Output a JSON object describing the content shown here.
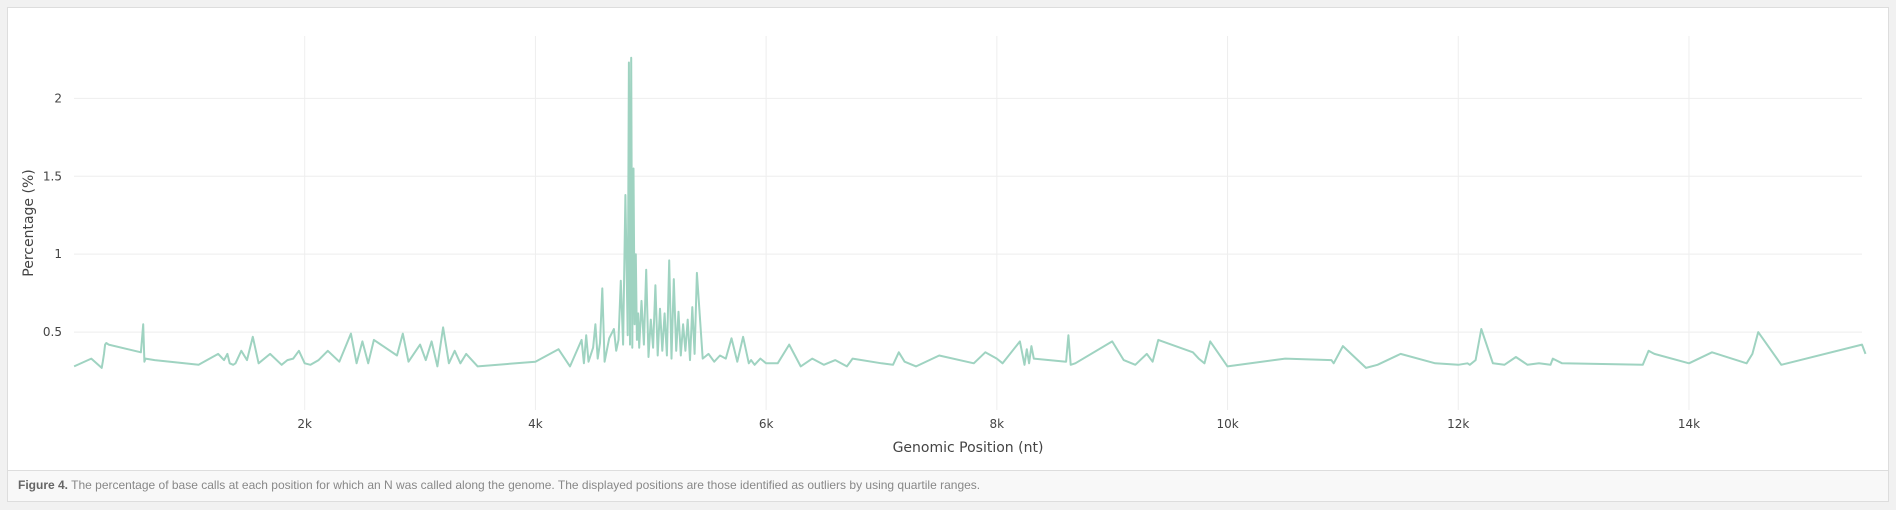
{
  "figure": {
    "label": "Figure 4.",
    "caption": "The percentage of base calls at each position for which an N was called along the genome. The displayed positions are those identified as outliers by using quartile ranges."
  },
  "chart_data": {
    "type": "line",
    "title": "",
    "xlabel": "Genomic Position (nt)",
    "ylabel": "Percentage (%)",
    "xlim": [
      0,
      15500
    ],
    "ylim": [
      0,
      2.4
    ],
    "xticks": [
      2000,
      4000,
      6000,
      8000,
      10000,
      12000,
      14000
    ],
    "xtick_labels": [
      "2k",
      "4k",
      "6k",
      "8k",
      "10k",
      "12k",
      "14k"
    ],
    "yticks": [
      0.5,
      1,
      1.5,
      2
    ],
    "ytick_labels": [
      "0.5",
      "1",
      "1.5",
      "2"
    ],
    "grid": true,
    "legend": "none",
    "line_color": "#9fd3c1",
    "series": [
      {
        "x": [
          1,
          150,
          240,
          250,
          260,
          270,
          280,
          300,
          580,
          600,
          610,
          620,
          700,
          1080,
          1250,
          1300,
          1330,
          1350,
          1380,
          1400,
          1450,
          1500,
          1550,
          1600,
          1700,
          1800,
          1850,
          1900,
          1950,
          2000,
          2050,
          2120,
          2200,
          2300,
          2350,
          2400,
          2450,
          2500,
          2550,
          2600,
          2800,
          2850,
          2900,
          3000,
          3050,
          3100,
          3150,
          3200,
          3250,
          3300,
          3350,
          3400,
          3500,
          4000,
          4200,
          4300,
          4400,
          4420,
          4440,
          4460,
          4500,
          4520,
          4540,
          4560,
          4580,
          4600,
          4640,
          4680,
          4700,
          4720,
          4740,
          4760,
          4780,
          4800,
          4810,
          4820,
          4830,
          4840,
          4850,
          4860,
          4870,
          4880,
          4890,
          4900,
          4920,
          4940,
          4960,
          4980,
          5000,
          5020,
          5040,
          5060,
          5080,
          5100,
          5120,
          5140,
          5160,
          5180,
          5200,
          5220,
          5240,
          5260,
          5280,
          5300,
          5320,
          5340,
          5360,
          5380,
          5400,
          5450,
          5500,
          5550,
          5600,
          5650,
          5700,
          5750,
          5800,
          5850,
          5870,
          5900,
          5950,
          6000,
          6100,
          6200,
          6300,
          6400,
          6500,
          6600,
          6700,
          6750,
          7000,
          7100,
          7150,
          7200,
          7300,
          7500,
          7800,
          7900,
          8000,
          8050,
          8200,
          8240,
          8260,
          8280,
          8300,
          8320,
          8600,
          8620,
          8640,
          8680,
          9000,
          9100,
          9200,
          9300,
          9350,
          9400,
          9700,
          9750,
          9800,
          9850,
          10000,
          10500,
          10900,
          10920,
          11000,
          11200,
          11300,
          11500,
          11800,
          12000,
          12080,
          12100,
          12150,
          12200,
          12300,
          12400,
          12500,
          12600,
          12700,
          12800,
          12820,
          12900,
          13600,
          13650,
          13700,
          14000,
          14200,
          14500,
          14550,
          14600,
          14800,
          15500,
          15530
        ],
        "y": [
          0.28,
          0.33,
          0.27,
          0.31,
          0.36,
          0.42,
          0.43,
          0.42,
          0.37,
          0.55,
          0.31,
          0.33,
          0.32,
          0.29,
          0.36,
          0.32,
          0.36,
          0.3,
          0.29,
          0.3,
          0.38,
          0.32,
          0.47,
          0.3,
          0.36,
          0.29,
          0.32,
          0.33,
          0.38,
          0.3,
          0.29,
          0.32,
          0.38,
          0.31,
          0.4,
          0.49,
          0.3,
          0.44,
          0.3,
          0.45,
          0.35,
          0.49,
          0.31,
          0.42,
          0.32,
          0.44,
          0.28,
          0.53,
          0.3,
          0.38,
          0.3,
          0.36,
          0.28,
          0.31,
          0.39,
          0.28,
          0.45,
          0.3,
          0.48,
          0.31,
          0.4,
          0.55,
          0.33,
          0.43,
          0.78,
          0.31,
          0.46,
          0.52,
          0.38,
          0.45,
          0.83,
          0.42,
          1.38,
          0.48,
          2.23,
          0.42,
          2.26,
          0.4,
          1.55,
          0.55,
          1.0,
          0.45,
          0.62,
          0.4,
          0.7,
          0.42,
          0.9,
          0.34,
          0.58,
          0.4,
          0.8,
          0.35,
          0.65,
          0.38,
          0.62,
          0.35,
          0.96,
          0.33,
          0.84,
          0.38,
          0.63,
          0.35,
          0.55,
          0.38,
          0.58,
          0.32,
          0.66,
          0.36,
          0.88,
          0.33,
          0.36,
          0.31,
          0.35,
          0.33,
          0.46,
          0.31,
          0.47,
          0.3,
          0.32,
          0.29,
          0.33,
          0.3,
          0.3,
          0.42,
          0.28,
          0.33,
          0.29,
          0.32,
          0.28,
          0.33,
          0.3,
          0.29,
          0.37,
          0.31,
          0.28,
          0.35,
          0.3,
          0.37,
          0.33,
          0.3,
          0.44,
          0.29,
          0.39,
          0.3,
          0.41,
          0.33,
          0.31,
          0.48,
          0.29,
          0.3,
          0.44,
          0.32,
          0.29,
          0.36,
          0.31,
          0.45,
          0.37,
          0.33,
          0.3,
          0.44,
          0.28,
          0.33,
          0.32,
          0.3,
          0.41,
          0.27,
          0.29,
          0.36,
          0.3,
          0.29,
          0.3,
          0.29,
          0.32,
          0.52,
          0.3,
          0.29,
          0.34,
          0.29,
          0.3,
          0.29,
          0.33,
          0.3,
          0.29,
          0.38,
          0.36,
          0.3,
          0.37,
          0.3,
          0.36,
          0.5,
          0.29,
          0.42,
          0.36
        ]
      }
    ]
  }
}
